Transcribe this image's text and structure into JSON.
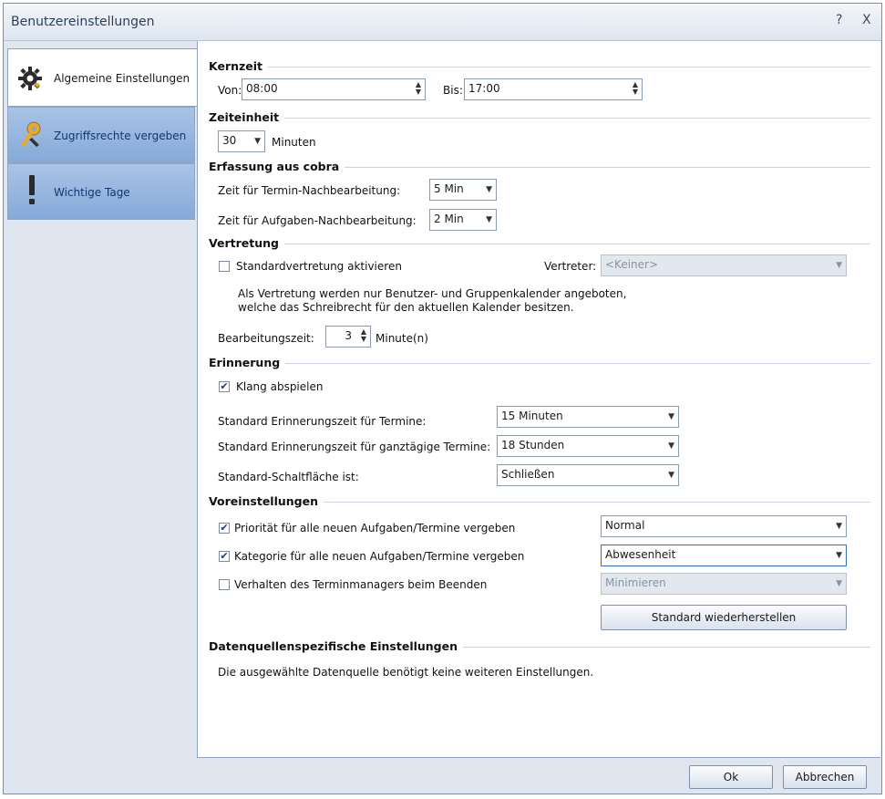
{
  "window": {
    "title": "Benutzereinstellungen",
    "help_glyph": "?",
    "close_glyph": "X"
  },
  "sidebar": {
    "items": [
      {
        "label": "Algemeine Einstellungen",
        "icon": "gear-icon",
        "active": true
      },
      {
        "label": "Zugriffsrechte vergeben",
        "icon": "key-icon",
        "active": false
      },
      {
        "label": "Wichtige Tage",
        "icon": "exclamation-icon",
        "active": false
      }
    ]
  },
  "kernzeit": {
    "title": "Kernzeit",
    "von_label": "Von:",
    "von_value": "08:00",
    "bis_label": "Bis:",
    "bis_value": "17:00"
  },
  "zeiteinheit": {
    "title": "Zeiteinheit",
    "value": "30",
    "unit": "Minuten"
  },
  "erfassung": {
    "title": "Erfassung aus cobra",
    "termin_label": "Zeit für Termin-Nachbearbeitung:",
    "termin_value": "5 Min",
    "aufgaben_label": "Zeit für Aufgaben-Nachbearbeitung:",
    "aufgaben_value": "2 Min"
  },
  "vertretung": {
    "title": "Vertretung",
    "checkbox_label": "Standardvertretung aktivieren",
    "checked": false,
    "vertreter_label": "Vertreter:",
    "vertreter_value": "<Keiner>",
    "info_line1": "Als Vertretung werden nur Benutzer- und Gruppenkalender angeboten,",
    "info_line2": "welche das Schreibrecht für den aktuellen Kalender besitzen.",
    "bearbeitung_label": "Bearbeitungszeit:",
    "bearbeitung_value": "3",
    "bearbeitung_unit": "Minute(n)"
  },
  "erinnerung": {
    "title": "Erinnerung",
    "klang_label": "Klang abspielen",
    "klang_checked": true,
    "termine_label": "Standard Erinnerungszeit für Termine:",
    "termine_value": "15 Minuten",
    "ganztaegig_label": "Standard Erinnerungszeit für ganztägige Termine:",
    "ganztaegig_value": "18 Stunden",
    "schaltflaeche_label": "Standard-Schaltfläche ist:",
    "schaltflaeche_value": "Schließen"
  },
  "voreinstellungen": {
    "title": "Voreinstellungen",
    "prioritaet_label": "Priorität für alle neuen Aufgaben/Termine vergeben",
    "prioritaet_checked": true,
    "prioritaet_value": "Normal",
    "kategorie_label": "Kategorie für alle neuen Aufgaben/Termine vergeben",
    "kategorie_checked": true,
    "kategorie_value": "Abwesenheit",
    "verhalten_label": "Verhalten des Terminmanagers beim Beenden",
    "verhalten_checked": false,
    "verhalten_value": "Minimieren",
    "reset_button": "Standard wiederherstellen"
  },
  "datenquelle": {
    "title": "Datenquellenspezifische Einstellungen",
    "text": "Die ausgewählte Datenquelle benötigt keine weiteren Einstellungen."
  },
  "footer": {
    "ok_label": "Ok",
    "cancel_label": "Abbrechen"
  }
}
